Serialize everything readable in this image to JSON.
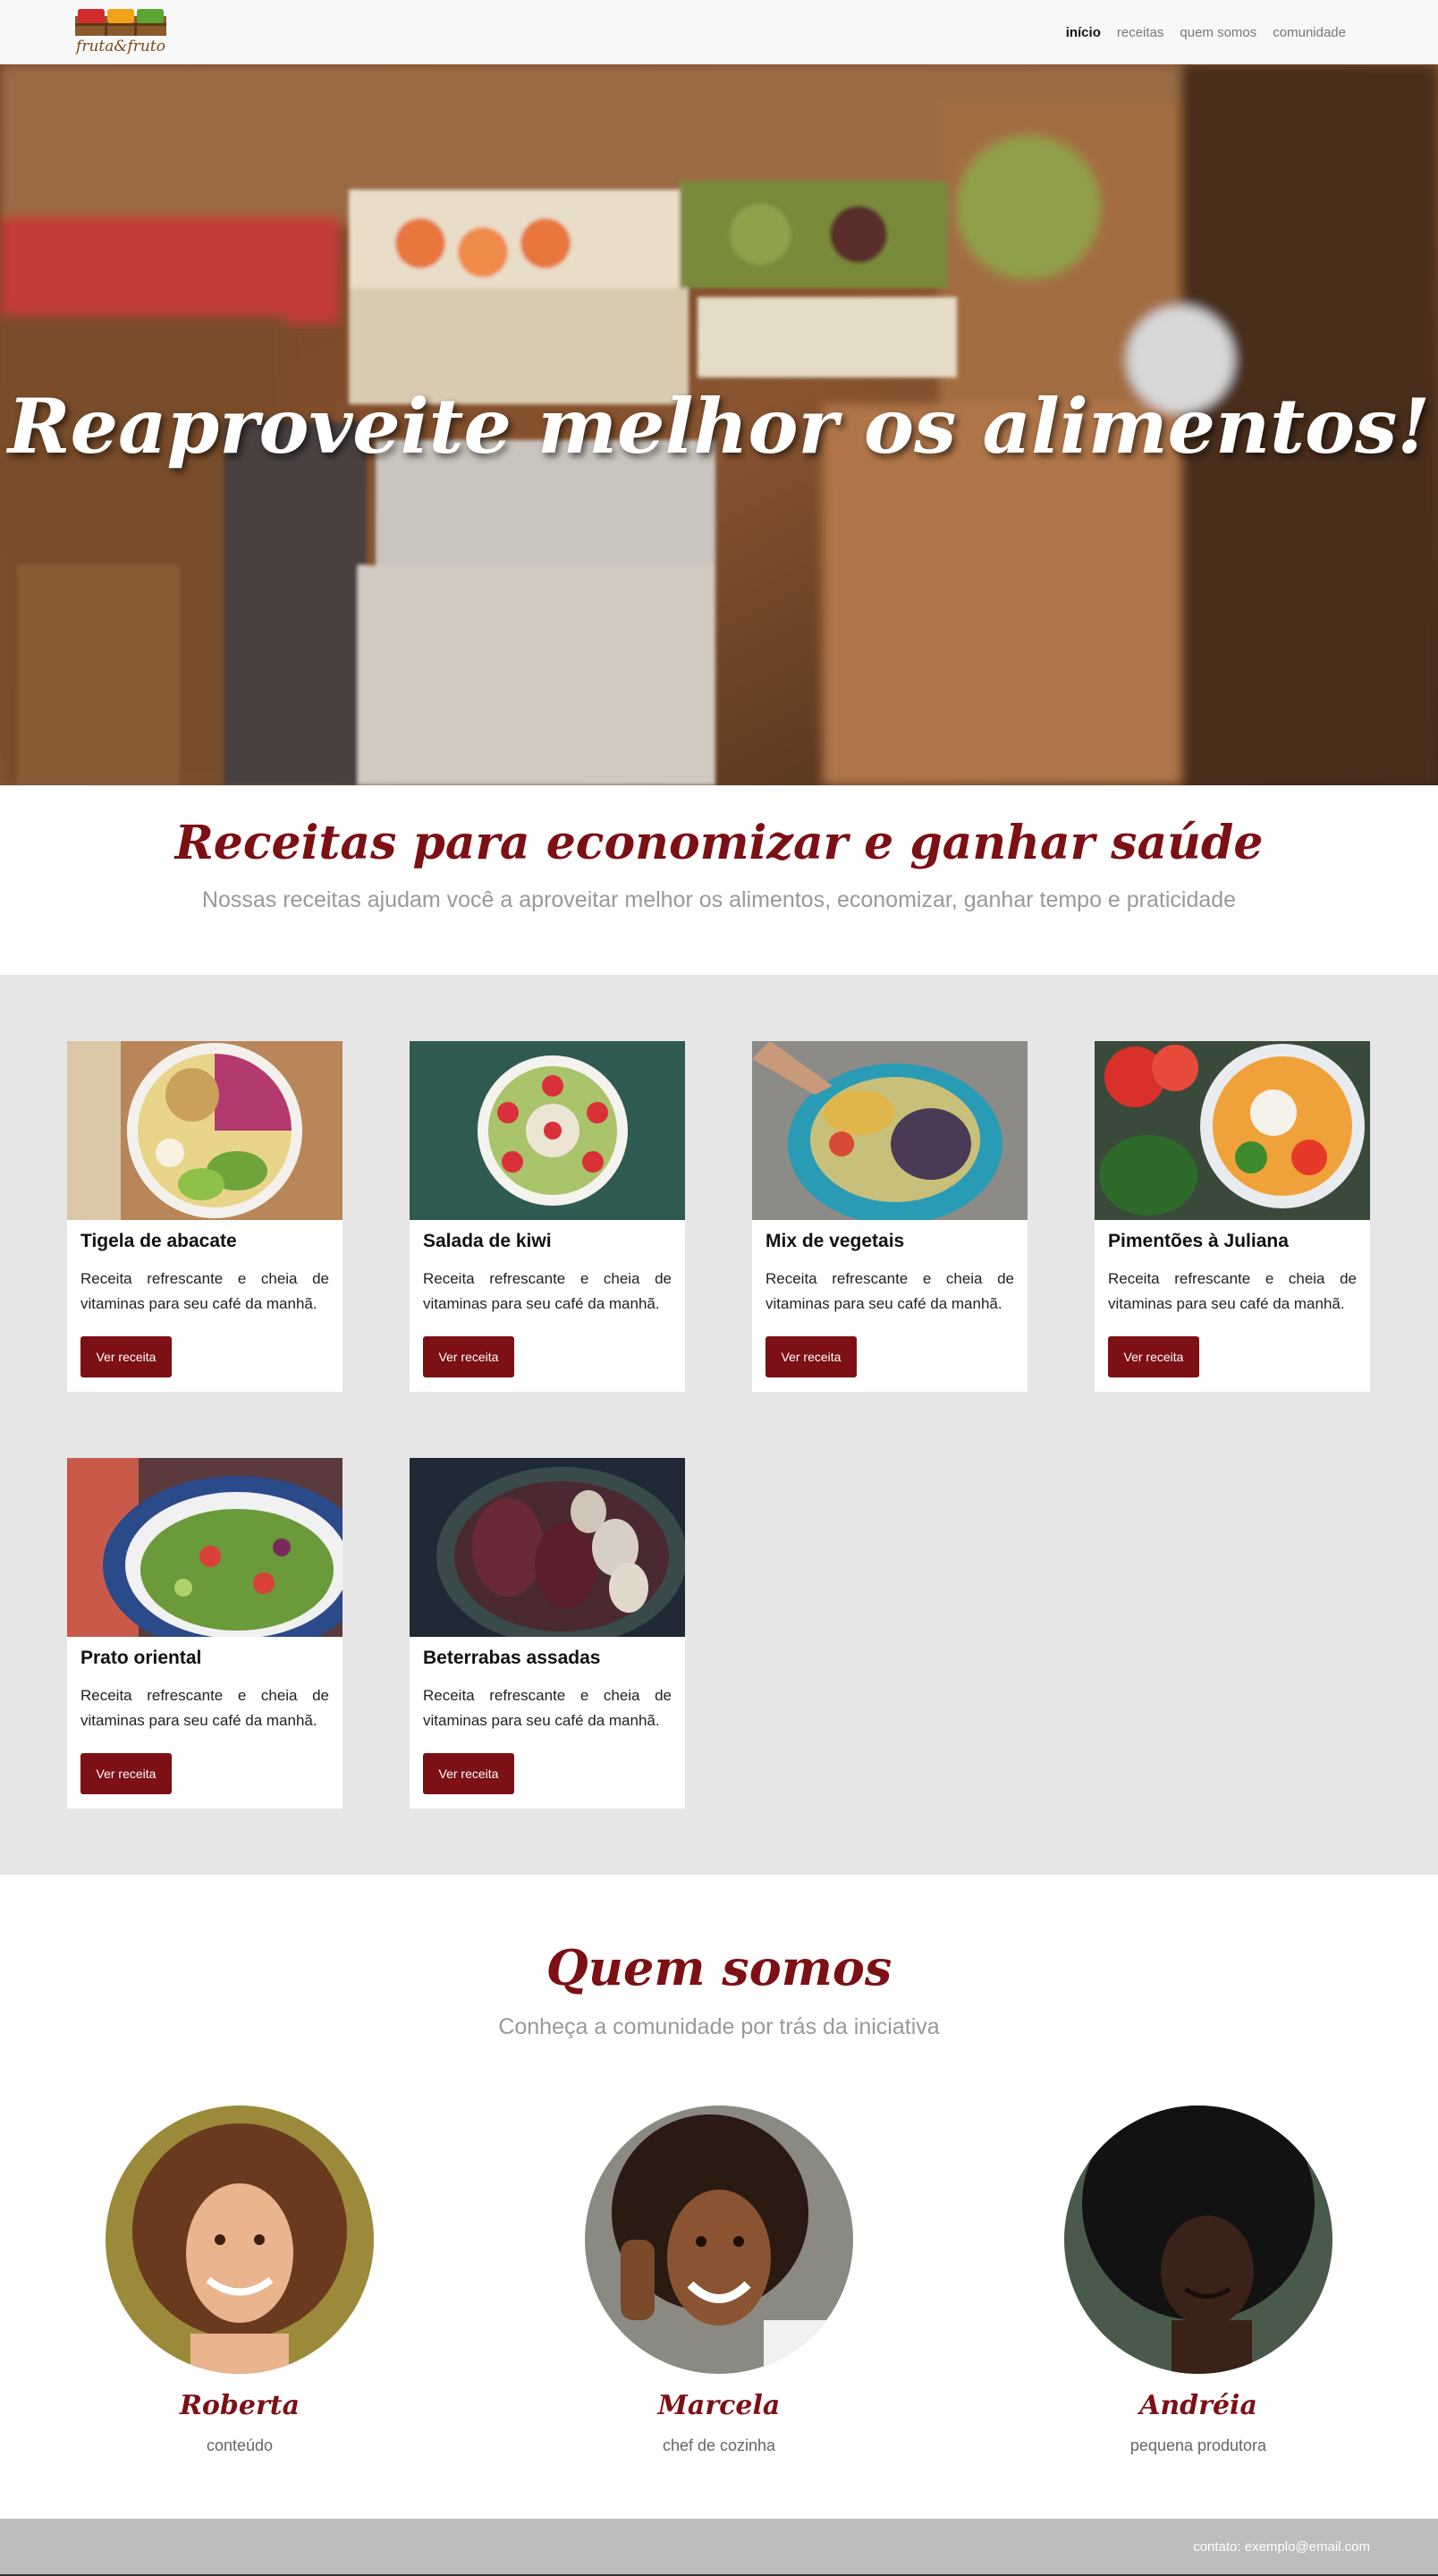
{
  "navbar": {
    "logo_text": "fruta&fruto",
    "links": [
      {
        "label": "início",
        "active": true
      },
      {
        "label": "receitas",
        "active": false
      },
      {
        "label": "quem somos",
        "active": false
      },
      {
        "label": "comunidade",
        "active": false
      }
    ]
  },
  "hero": {
    "title": "Reaproveite melhor os alimentos!"
  },
  "intro": {
    "title": "Receitas para economizar e ganhar saúde",
    "subtitle": "Nossas receitas ajudam você a aproveitar melhor os alimentos, economizar, ganhar tempo e praticidade"
  },
  "recipes": [
    {
      "title": "Tigela de abacate",
      "text": "Receita refrescante e cheia de vitaminas para seu café da manhã.",
      "button": "Ver receita"
    },
    {
      "title": "Salada de kiwi",
      "text": "Receita refrescante e cheia de vitaminas para seu café da manhã.",
      "button": "Ver receita"
    },
    {
      "title": "Mix de vegetais",
      "text": "Receita refrescante e cheia de vitaminas para seu café da manhã.",
      "button": "Ver receita"
    },
    {
      "title": "Pimentões à Juliana",
      "text": "Receita refrescante e cheia de vitaminas para seu café da manhã.",
      "button": "Ver receita"
    },
    {
      "title": "Prato oriental",
      "text": "Receita refrescante e cheia de vitaminas para seu café da manhã.",
      "button": "Ver receita"
    },
    {
      "title": "Beterrabas assadas",
      "text": "Receita refrescante e cheia de vitaminas para seu café da manhã.",
      "button": "Ver receita"
    }
  ],
  "about": {
    "title": "Quem somos",
    "subtitle": "Conheça a comunidade por trás da iniciativa",
    "members": [
      {
        "name": "Roberta",
        "role": "conteúdo"
      },
      {
        "name": "Marcela",
        "role": "chef de cozinha"
      },
      {
        "name": "Andréia",
        "role": "pequena produtora"
      }
    ]
  },
  "footer": {
    "contact": "contato: exemplo@email.com"
  },
  "colors": {
    "brand": "#7c1015",
    "recipes_bg": "#e6e6e6",
    "footer_bg": "#bdbdbd",
    "navbar_bg": "#f8f8f8"
  }
}
